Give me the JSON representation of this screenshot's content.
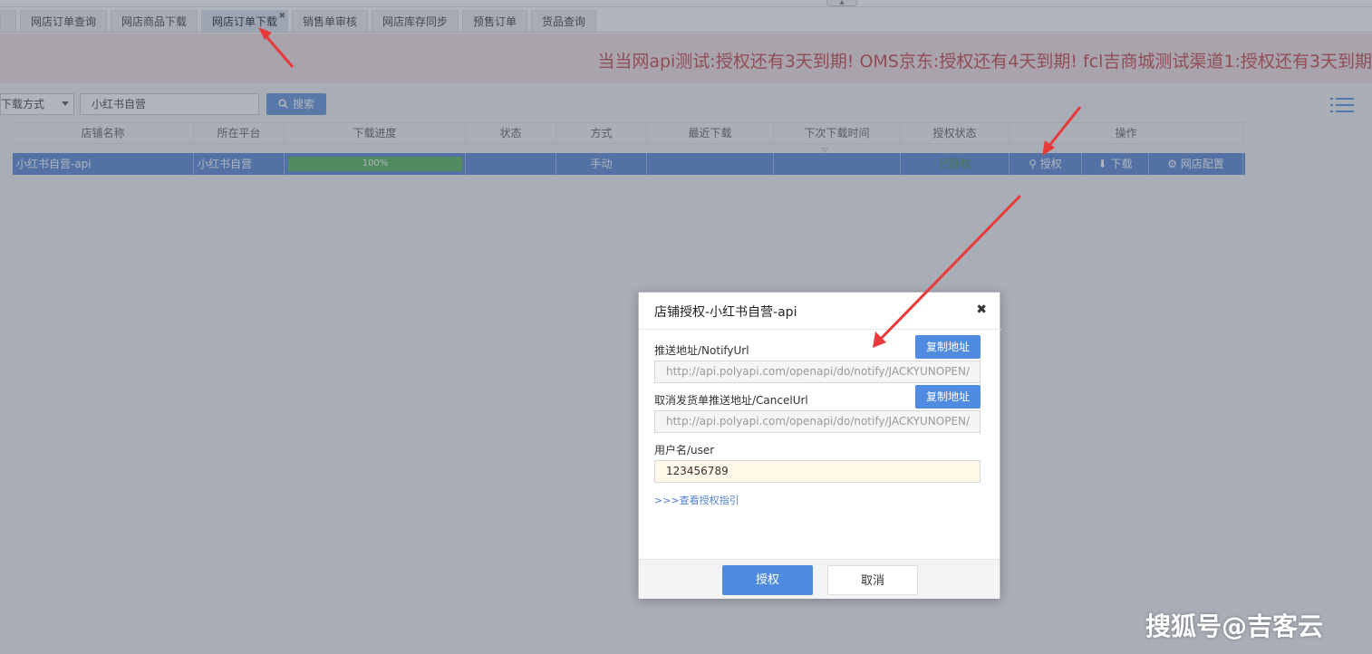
{
  "tabs": [
    {
      "label": "网店订单查询"
    },
    {
      "label": "网店商品下载"
    },
    {
      "label": "网店订单下载",
      "active": true,
      "close_glyph": "✖"
    },
    {
      "label": "销售单审核"
    },
    {
      "label": "网店库存同步"
    },
    {
      "label": "预售订单"
    },
    {
      "label": "货品查询"
    }
  ],
  "notice": "当当网api测试:授权还有3天到期!   OMS京东:授权还有4天到期!   fcl吉商城测试渠道1:授权还有3天到期",
  "toolbar": {
    "mode_select": "下载方式",
    "search_value": "小红书自营",
    "search_label": "搜索",
    "search_icon": "search-icon",
    "view_icon": "list-view-icon"
  },
  "grid": {
    "headers": [
      "店铺名称",
      "所在平台",
      "下载进度",
      "状态",
      "方式",
      "最近下载",
      "下次下载时间",
      "授权状态",
      "操作"
    ],
    "row": {
      "shop_name": "小红书自营-api",
      "platform": "小红书自营",
      "progress": 100,
      "progress_label": "100%",
      "status": "",
      "method": "手动",
      "last_download": "",
      "next_download": "",
      "auth_status": "已授权",
      "actions": {
        "authorize": "授权",
        "download": "下载",
        "config": "网店配置"
      }
    }
  },
  "dialog": {
    "title": "店铺授权-小红书自营-api",
    "close_glyph": "✖",
    "notify_label": "推送地址/NotifyUrl",
    "notify_value": "http://api.polyapi.com/openapi/do/notify/JACKYUNOPEN/",
    "copy_label": "复制地址",
    "cancel_url_label": "取消发货单推送地址/CancelUrl",
    "cancel_url_value": "http://api.polyapi.com/openapi/do/notify/JACKYUNOPEN/",
    "user_label": "用户名/user",
    "user_value": "123456789",
    "guide_link": ">>>查看授权指引",
    "ok_label": "授权",
    "cancel_label": "取消"
  },
  "watermark": "搜狐号@吉客云",
  "colors": {
    "accent": "#4f8be0",
    "row_selected": "#4f7fcf",
    "notice_text": "#c53a3a",
    "annotation_arrow": "#e83a3a"
  }
}
